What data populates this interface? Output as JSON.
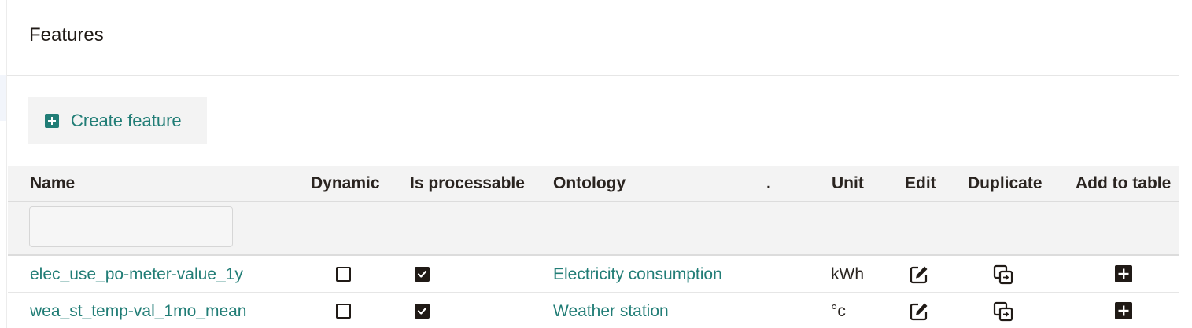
{
  "page": {
    "title": "Features"
  },
  "toolbar": {
    "create_label": "Create feature",
    "create_icon": "plus-square-icon"
  },
  "table": {
    "columns": [
      "Name",
      "Dynamic",
      "Is processable",
      "Ontology",
      ".",
      "Unit",
      "Edit",
      "Duplicate",
      "Add to table"
    ],
    "filter": {
      "value": "",
      "placeholder": ""
    },
    "rows": [
      {
        "name": "elec_use_po-meter-value_1y",
        "dynamic": false,
        "is_processable": true,
        "ontology": "Electricity consumption",
        "dot": "",
        "unit": "kWh"
      },
      {
        "name": "wea_st_temp-val_1mo_mean",
        "dynamic": false,
        "is_processable": true,
        "ontology": "Weather station",
        "dot": "",
        "unit": "°c"
      }
    ]
  },
  "colors": {
    "accent": "#217d76",
    "text": "#201a16",
    "header_bg": "#f3f3f3"
  },
  "icons": {
    "edit": "edit-icon",
    "duplicate": "duplicate-icon",
    "add": "plus-square-icon",
    "checkbox_checked": "checkbox-checked-icon",
    "checkbox_unchecked": "checkbox-unchecked-icon"
  }
}
